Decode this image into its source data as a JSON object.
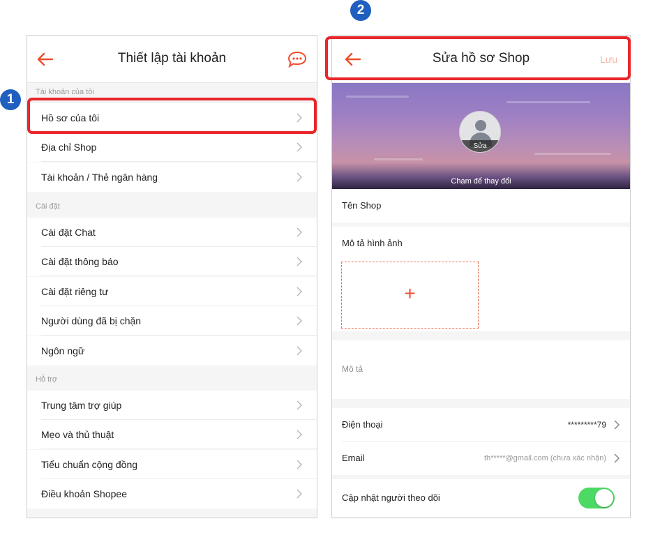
{
  "steps": {
    "one": "1",
    "two": "2"
  },
  "colors": {
    "accent": "#ee4d2d",
    "highlight": "#e8262b",
    "step_badge": "#1f5fbf",
    "toggle_on": "#4cd964"
  },
  "left": {
    "title": "Thiết lập tài khoản",
    "back_icon": "arrow-left-icon",
    "chat_icon": "chat-bubble-icon",
    "sections": [
      {
        "label": "Tài khoản của tôi",
        "items": [
          "Hồ sơ của tôi",
          "Địa chỉ Shop",
          "Tài khoản / Thẻ ngân hàng"
        ]
      },
      {
        "label": "Cài đặt",
        "items": [
          "Cài đặt Chat",
          "Cài đặt thông báo",
          "Cài đặt riêng tư",
          "Người dùng đã bị chặn",
          "Ngôn ngữ"
        ]
      },
      {
        "label": "Hỗ trợ",
        "items": [
          "Trung tâm trợ giúp",
          "Mẹo và thủ thuật",
          "Tiểu chuẩn cộng đồng",
          "Điều khoản Shopee"
        ]
      }
    ]
  },
  "right": {
    "title": "Sửa hồ sơ Shop",
    "save_label": "Lưu",
    "back_icon": "arrow-left-icon",
    "avatar_edit": "Sửa",
    "cover_hint": "Chạm để thay đổi",
    "shop_name_label": "Tên Shop",
    "image_desc_label": "Mô tả hình ảnh",
    "upload_plus": "+",
    "description_placeholder": "Mô tả",
    "phone_label": "Điện thoại",
    "phone_value": "*********79",
    "email_label": "Email",
    "email_value": "th*****@gmail.com (chưa xác nhận)",
    "follow_label": "Cập nhật người theo dõi",
    "follow_enabled": true
  }
}
